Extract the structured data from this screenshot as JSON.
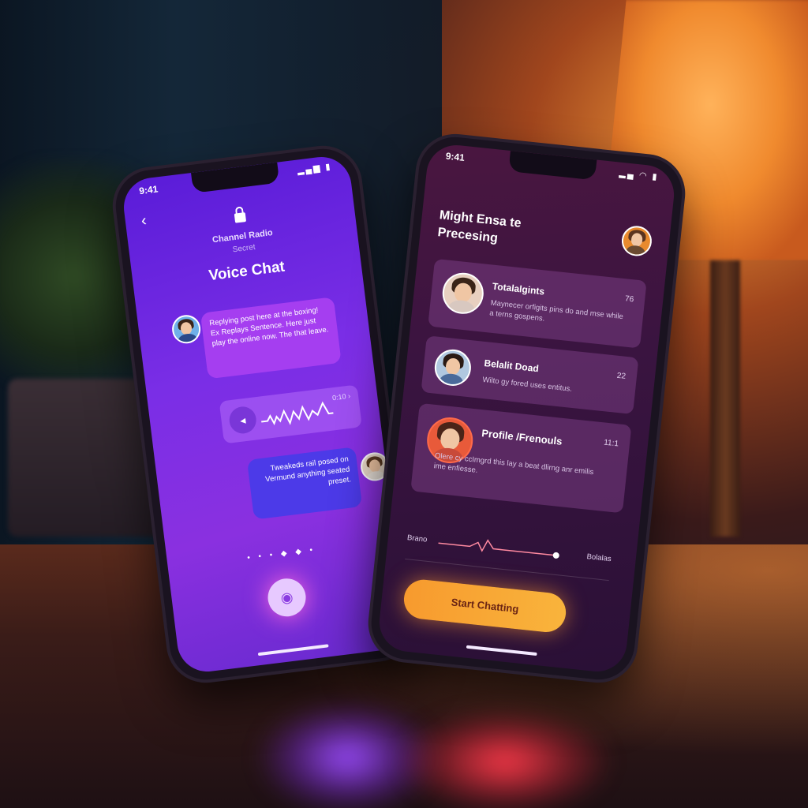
{
  "left_phone": {
    "status_time": "9:41",
    "status_icons": "▂▄▆ ▮",
    "back_label": "‹",
    "room_name": "Channel Radio",
    "room_sub": "Secret",
    "title": "Voice Chat",
    "incoming_message": "Replying post here at the boxing! Ex Replays Sentence. Here just play the online now. The that leave.",
    "voice_note_time": "0:10 ›",
    "outgoing_message": "Tweakeds rail posed on Vermund anything seated preset.",
    "page_dots": "• • • ◆ ◆ •",
    "mic_label": "◉"
  },
  "right_phone": {
    "status_time": "9:41",
    "status_icons": "▂▄ ◠ ▮",
    "title": "Might Ensa te Precesing",
    "cards": [
      {
        "name": "Totalalgints",
        "meta": "76",
        "desc": "Maynecer orfigits pins do and mse while a terns gospens."
      },
      {
        "name": "Belalit Doad",
        "meta": "22",
        "desc": "Wilto gy fored uses entitus."
      },
      {
        "name": "Profile /Frenouls",
        "meta": "11:1",
        "desc": "Olere cy ccImgrd this lay a beat dlirng anr emilis ime enfiesse."
      }
    ],
    "slider_left": "Brano",
    "slider_right": "Bolalas",
    "cta_label": "Start Chatting"
  },
  "colors": {
    "left_screen": "#7a2ee6",
    "right_screen": "#3a1440",
    "cta": "#f9a83a",
    "lamp": "#f08a2e"
  }
}
